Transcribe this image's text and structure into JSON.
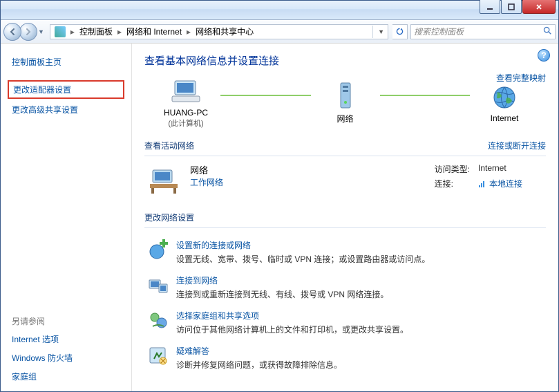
{
  "titlebar": {},
  "nav": {
    "crumbs": [
      "控制面板",
      "网络和 Internet",
      "网络和共享中心"
    ],
    "bc_root_tip": "▸",
    "dropdown_tip": "▾",
    "search_placeholder": "搜索控制面板"
  },
  "sidebar": {
    "home": "控制面板主页",
    "adapter": "更改适配器设置",
    "advanced_sharing": "更改高级共享设置",
    "see_also_header": "另请参阅",
    "see_also": [
      "Internet 选项",
      "Windows 防火墙",
      "家庭组"
    ]
  },
  "content": {
    "heading": "查看基本网络信息并设置连接",
    "view_full_map": "查看完整映射",
    "map": {
      "pc_name": "HUANG-PC",
      "pc_sub": "(此计算机)",
      "network_label": "网络",
      "internet_label": "Internet"
    },
    "active_networks_header": "查看活动网络",
    "conn_disc_link": "连接或断开连接",
    "active_network": {
      "name": "网络",
      "type_link": "工作网络",
      "access_type_label": "访问类型:",
      "access_type_value": "Internet",
      "connections_label": "连接:",
      "connections_value": "本地连接"
    },
    "change_settings_header": "更改网络设置",
    "options": [
      {
        "title": "设置新的连接或网络",
        "desc": "设置无线、宽带、拨号、临时或 VPN 连接；或设置路由器或访问点。"
      },
      {
        "title": "连接到网络",
        "desc": "连接到或重新连接到无线、有线、拨号或 VPN 网络连接。"
      },
      {
        "title": "选择家庭组和共享选项",
        "desc": "访问位于其他网络计算机上的文件和打印机，或更改共享设置。"
      },
      {
        "title": "疑难解答",
        "desc": "诊断并修复网络问题，或获得故障排除信息。"
      }
    ]
  }
}
